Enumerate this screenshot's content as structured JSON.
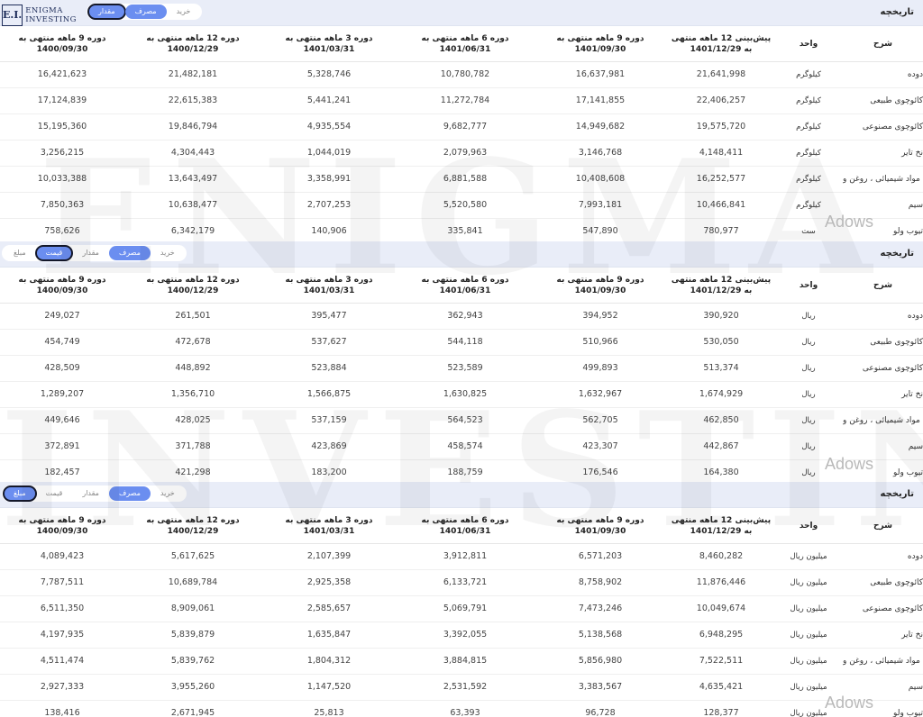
{
  "logo": {
    "mark": "E.I.",
    "line1": "ENIGMA",
    "line2": "INVESTING"
  },
  "watermark": {
    "line1": "ENIGMA",
    "line2": "INVESTING"
  },
  "adows": "Adows",
  "headers": {
    "name": "شرح",
    "unit": "واحد",
    "est": "پیش‌بینی 12 ماهه منتهی به 1401/12/29",
    "m9": "دوره 9 ماهه منتهی به 1401/09/30",
    "m6": "دوره 6 ماهه منتهی به 1401/06/31",
    "m3": "دوره 3 ماهه منتهی به 1401/03/31",
    "m12": "دوره 12 ماهه منتهی به 1400/12/29",
    "m9old": "دوره 9 ماهه منتهی به 1400/09/30"
  },
  "panels": [
    {
      "title": "تاریخچه",
      "tabs": [
        "خرید",
        "مصرف",
        "مقدار"
      ],
      "rows": [
        {
          "name": "دوده",
          "unit": "کیلوگرم",
          "v": [
            "21,641,998",
            "16,637,981",
            "10,780,782",
            "5,328,746",
            "21,482,181",
            "16,421,623"
          ]
        },
        {
          "name": "کائوچوی طبیعی",
          "unit": "کیلوگرم",
          "v": [
            "22,406,257",
            "17,141,855",
            "11,272,784",
            "5,441,241",
            "22,615,383",
            "17,124,839"
          ]
        },
        {
          "name": "کائوچوی مصنوعی",
          "unit": "کیلوگرم",
          "v": [
            "19,575,720",
            "14,949,682",
            "9,682,777",
            "4,935,554",
            "19,846,794",
            "15,195,360"
          ]
        },
        {
          "name": "نخ تایر",
          "unit": "کیلوگرم",
          "v": [
            "4,148,411",
            "3,146,768",
            "2,079,963",
            "1,044,019",
            "4,304,443",
            "3,256,215"
          ]
        },
        {
          "name": "مواد شیمیائی ، روغن و ...",
          "unit": "کیلوگرم",
          "v": [
            "16,252,577",
            "10,408,608",
            "6,881,588",
            "3,358,991",
            "13,643,497",
            "10,033,388"
          ]
        },
        {
          "name": "سیم",
          "unit": "کیلوگرم",
          "v": [
            "10,466,841",
            "7,993,181",
            "5,520,580",
            "2,707,253",
            "10,638,477",
            "7,850,363"
          ]
        },
        {
          "name": "تیوب ولو",
          "unit": "ست",
          "v": [
            "780,977",
            "547,890",
            "335,841",
            "140,906",
            "6,342,179",
            "758,626"
          ]
        }
      ]
    },
    {
      "title": "تاریخچه",
      "tabs": [
        "خرید",
        "مصرف",
        "مقدار",
        "قیمت",
        "مبلغ"
      ],
      "rows": [
        {
          "name": "دوده",
          "unit": "ریال",
          "v": [
            "390,920",
            "394,952",
            "362,943",
            "395,477",
            "261,501",
            "249,027"
          ]
        },
        {
          "name": "کائوچوی طبیعی",
          "unit": "ریال",
          "v": [
            "530,050",
            "510,966",
            "544,118",
            "537,627",
            "472,678",
            "454,749"
          ]
        },
        {
          "name": "کائوچوی مصنوعی",
          "unit": "ریال",
          "v": [
            "513,374",
            "499,893",
            "523,589",
            "523,884",
            "448,892",
            "428,509"
          ]
        },
        {
          "name": "نخ تایر",
          "unit": "ریال",
          "v": [
            "1,674,929",
            "1,632,967",
            "1,630,825",
            "1,566,875",
            "1,356,710",
            "1,289,207"
          ]
        },
        {
          "name": "مواد شیمیائی ، روغن و ...",
          "unit": "ریال",
          "v": [
            "462,850",
            "562,705",
            "564,523",
            "537,159",
            "428,025",
            "449,646"
          ]
        },
        {
          "name": "سیم",
          "unit": "ریال",
          "v": [
            "442,867",
            "423,307",
            "458,574",
            "423,869",
            "371,788",
            "372,891"
          ]
        },
        {
          "name": "تیوب ولو",
          "unit": "ریال",
          "v": [
            "164,380",
            "176,546",
            "188,759",
            "183,200",
            "421,298",
            "182,457"
          ]
        }
      ]
    },
    {
      "title": "تاریخچه",
      "tabs": [
        "خرید",
        "مصرف",
        "مقدار",
        "قیمت",
        "مبلغ"
      ],
      "rows": [
        {
          "name": "دوده",
          "unit": "میلیون ریال",
          "v": [
            "8,460,282",
            "6,571,203",
            "3,912,811",
            "2,107,399",
            "5,617,625",
            "4,089,423"
          ]
        },
        {
          "name": "کائوچوی طبیعی",
          "unit": "میلیون ریال",
          "v": [
            "11,876,446",
            "8,758,902",
            "6,133,721",
            "2,925,358",
            "10,689,784",
            "7,787,511"
          ]
        },
        {
          "name": "کائوچوی مصنوعی",
          "unit": "میلیون ریال",
          "v": [
            "10,049,674",
            "7,473,246",
            "5,069,791",
            "2,585,657",
            "8,909,061",
            "6,511,350"
          ]
        },
        {
          "name": "نخ تایر",
          "unit": "میلیون ریال",
          "v": [
            "6,948,295",
            "5,138,568",
            "3,392,055",
            "1,635,847",
            "5,839,879",
            "4,197,935"
          ]
        },
        {
          "name": "مواد شیمیائی ، روغن و ...",
          "unit": "میلیون ریال",
          "v": [
            "7,522,511",
            "5,856,980",
            "3,884,815",
            "1,804,312",
            "5,839,762",
            "4,511,474"
          ]
        },
        {
          "name": "سیم",
          "unit": "میلیون ریال",
          "v": [
            "4,635,421",
            "3,383,567",
            "2,531,592",
            "1,147,520",
            "3,955,260",
            "2,927,333"
          ]
        },
        {
          "name": "تیوب ولو",
          "unit": "میلیون ریال",
          "v": [
            "128,377",
            "96,728",
            "63,393",
            "25,813",
            "2,671,945",
            "138,416"
          ]
        }
      ]
    }
  ]
}
